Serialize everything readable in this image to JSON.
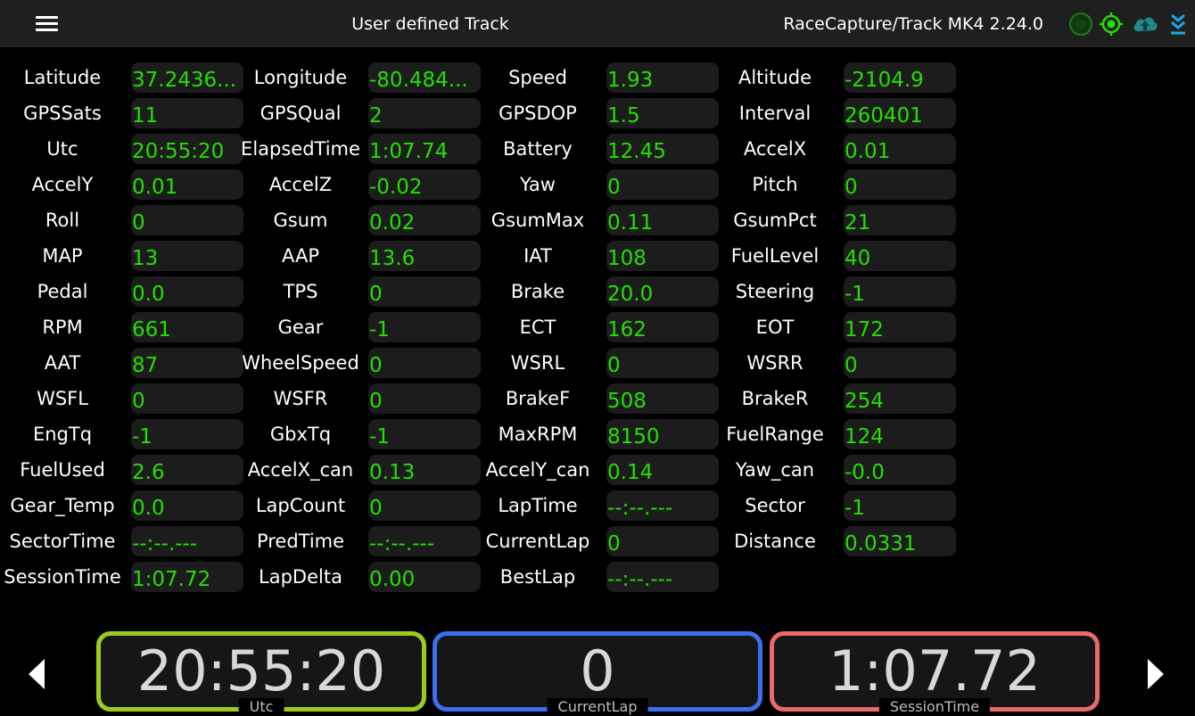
{
  "header": {
    "track_title": "User defined Track",
    "device_title": "RaceCapture/Track MK4 2.24.0",
    "icons": [
      "menu-icon",
      "record-status-icon",
      "gps-target-icon",
      "cloud-upload-icon",
      "download-arrow-icon"
    ],
    "icon_colors": {
      "record": "#1b7a1b",
      "gps": "#22e000",
      "cloud": "#1f8a8a",
      "download": "#1aa9e6"
    }
  },
  "columns": [
    {
      "rows": [
        {
          "label": "Latitude",
          "value": "37.2436..."
        },
        {
          "label": "GPSSats",
          "value": "11"
        },
        {
          "label": "Utc",
          "value": "20:55:20"
        },
        {
          "label": "AccelY",
          "value": "0.01"
        },
        {
          "label": "Roll",
          "value": "0"
        },
        {
          "label": "MAP",
          "value": "13"
        },
        {
          "label": "Pedal",
          "value": "0.0"
        },
        {
          "label": "RPM",
          "value": "661"
        },
        {
          "label": "AAT",
          "value": "87"
        },
        {
          "label": "WSFL",
          "value": "0"
        },
        {
          "label": "EngTq",
          "value": "-1"
        },
        {
          "label": "FuelUsed",
          "value": "2.6"
        },
        {
          "label": "Gear_Temp",
          "value": "0.0"
        },
        {
          "label": "SectorTime",
          "value": "--:--.---"
        },
        {
          "label": "SessionTime",
          "value": "1:07.72"
        }
      ]
    },
    {
      "rows": [
        {
          "label": "Longitude",
          "value": "-80.484..."
        },
        {
          "label": "GPSQual",
          "value": "2"
        },
        {
          "label": "ElapsedTime",
          "value": "1:07.74"
        },
        {
          "label": "AccelZ",
          "value": "-0.02"
        },
        {
          "label": "Gsum",
          "value": "0.02"
        },
        {
          "label": "AAP",
          "value": "13.6"
        },
        {
          "label": "TPS",
          "value": "0"
        },
        {
          "label": "Gear",
          "value": "-1"
        },
        {
          "label": "WheelSpeed",
          "value": "0"
        },
        {
          "label": "WSFR",
          "value": "0"
        },
        {
          "label": "GbxTq",
          "value": "-1"
        },
        {
          "label": "AccelX_can",
          "value": "0.13"
        },
        {
          "label": "LapCount",
          "value": "0"
        },
        {
          "label": "PredTime",
          "value": "--:--.---"
        },
        {
          "label": "LapDelta",
          "value": "0.00"
        }
      ]
    },
    {
      "rows": [
        {
          "label": "Speed",
          "value": "1.93"
        },
        {
          "label": "GPSDOP",
          "value": "1.5"
        },
        {
          "label": "Battery",
          "value": "12.45"
        },
        {
          "label": "Yaw",
          "value": "0"
        },
        {
          "label": "GsumMax",
          "value": "0.11"
        },
        {
          "label": "IAT",
          "value": "108"
        },
        {
          "label": "Brake",
          "value": "20.0"
        },
        {
          "label": "ECT",
          "value": "162"
        },
        {
          "label": "WSRL",
          "value": "0"
        },
        {
          "label": "BrakeF",
          "value": "508"
        },
        {
          "label": "MaxRPM",
          "value": "8150"
        },
        {
          "label": "AccelY_can",
          "value": "0.14"
        },
        {
          "label": "LapTime",
          "value": "--:--.---"
        },
        {
          "label": "CurrentLap",
          "value": "0"
        },
        {
          "label": "BestLap",
          "value": "--:--.---"
        }
      ]
    },
    {
      "rows": [
        {
          "label": "Altitude",
          "value": "-2104.9"
        },
        {
          "label": "Interval",
          "value": "260401"
        },
        {
          "label": "AccelX",
          "value": "0.01"
        },
        {
          "label": "Pitch",
          "value": "0"
        },
        {
          "label": "GsumPct",
          "value": "21"
        },
        {
          "label": "FuelLevel",
          "value": "40"
        },
        {
          "label": "Steering",
          "value": "-1"
        },
        {
          "label": "EOT",
          "value": "172"
        },
        {
          "label": "WSRR",
          "value": "0"
        },
        {
          "label": "BrakeR",
          "value": "254"
        },
        {
          "label": "FuelRange",
          "value": "124"
        },
        {
          "label": "Yaw_can",
          "value": "-0.0"
        },
        {
          "label": "Sector",
          "value": "-1"
        },
        {
          "label": "Distance",
          "value": "0.0331"
        }
      ]
    }
  ],
  "gauges": [
    {
      "value": "20:55:20",
      "label": "Utc",
      "color": "#9acd1a"
    },
    {
      "value": "0",
      "label": "CurrentLap",
      "color": "#3a6ff0"
    },
    {
      "value": "1:07.72",
      "label": "SessionTime",
      "color": "#e86a6a"
    }
  ],
  "navigation": {
    "prev_icon": "chevron-left-icon",
    "next_icon": "chevron-right-icon"
  }
}
